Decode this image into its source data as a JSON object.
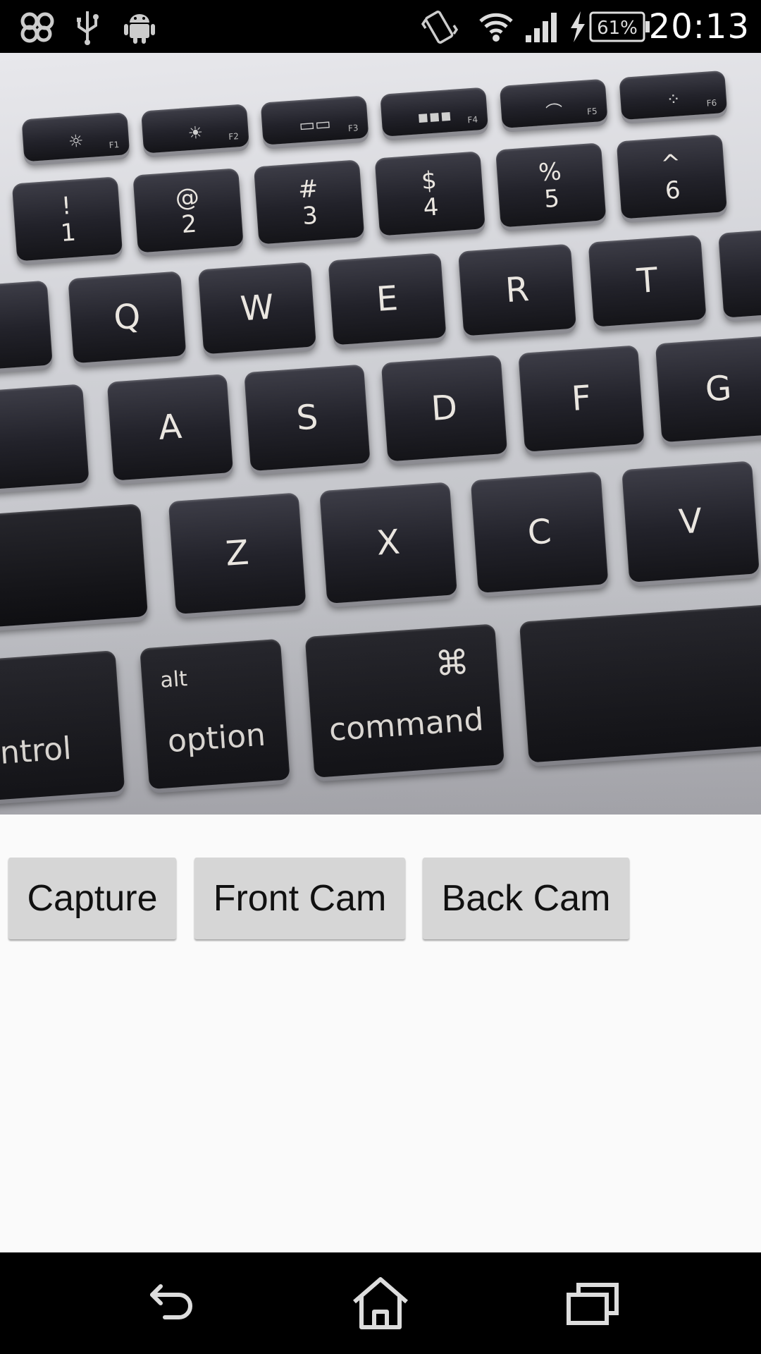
{
  "status_bar": {
    "icons": [
      "app-notification-icon",
      "usb-icon",
      "android-debug-icon",
      "vibrate-icon",
      "wifi-icon",
      "signal-icon",
      "charging-icon",
      "battery-icon"
    ],
    "battery_percent": "61%",
    "time": "20:13"
  },
  "camera_preview": {
    "subject": "laptop keyboard",
    "keys": {
      "f1": "F1",
      "f2": "F2",
      "f3": "F3",
      "f4": "F4",
      "f5": "F5",
      "f6": "F6",
      "n1_top": "!",
      "n1": "1",
      "n2_top": "@",
      "n2": "2",
      "n3_top": "#",
      "n3": "3",
      "n4_top": "$",
      "n4": "4",
      "n5_top": "%",
      "n5": "5",
      "n6_top": "^",
      "n6": "6",
      "q": "Q",
      "w": "W",
      "e": "E",
      "r": "R",
      "t": "T",
      "a": "A",
      "s": "S",
      "d": "D",
      "f": "F",
      "g": "G",
      "z": "Z",
      "x": "X",
      "c": "C",
      "v": "V",
      "control": "ontrol",
      "option_alt": "alt",
      "option": "option",
      "command_symbol": "⌘",
      "command": "command"
    }
  },
  "buttons": {
    "capture": "Capture",
    "front_cam": "Front Cam",
    "back_cam": "Back Cam"
  },
  "nav_bar": {
    "icons": [
      "back-icon",
      "home-icon",
      "recent-apps-icon"
    ]
  }
}
